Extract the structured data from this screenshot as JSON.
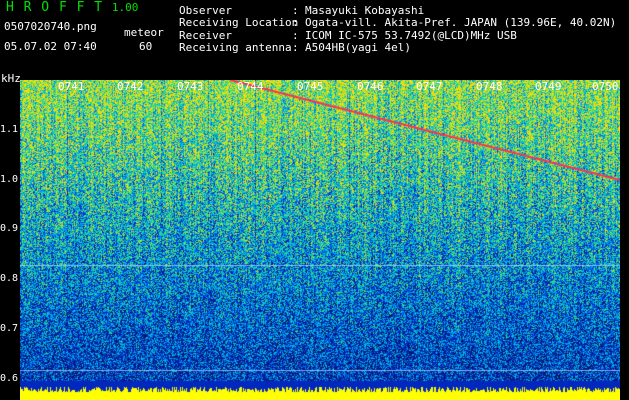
{
  "header": {
    "app_name": "H R O F F T",
    "app_version": "1.00",
    "filename": "0507020740.png",
    "mode_label": "meteor",
    "datetime": "05.07.02 07:40",
    "mode_value": "60"
  },
  "info": {
    "rows": [
      {
        "key": "Observer",
        "sep": ":",
        "value": "Masayuki Kobayashi"
      },
      {
        "key": "Receiving Location",
        "sep": ":",
        "value": "Ogata-vill. Akita-Pref. JAPAN (139.96E, 40.02N)"
      },
      {
        "key": "Receiver",
        "sep": ":",
        "value": "ICOM IC-575 53.7492(@LCD)MHz USB"
      },
      {
        "key": "Receiving antenna",
        "sep": ":",
        "value": "A504HB(yagi 4el)"
      }
    ]
  },
  "axis": {
    "unit": "kHz",
    "y_labels": [
      "1.1",
      "1.0",
      "0.9",
      "0.8",
      "0.7",
      "0.6"
    ],
    "x_labels": [
      "0741",
      "0742",
      "0743",
      "0744",
      "0745",
      "0746",
      "0747",
      "0748",
      "0749",
      "0750"
    ]
  },
  "colors": {
    "title_green": "#00e000",
    "trace_red": "#ff3050",
    "baseline_yellow": "#ffff00",
    "background": "#000000"
  }
}
